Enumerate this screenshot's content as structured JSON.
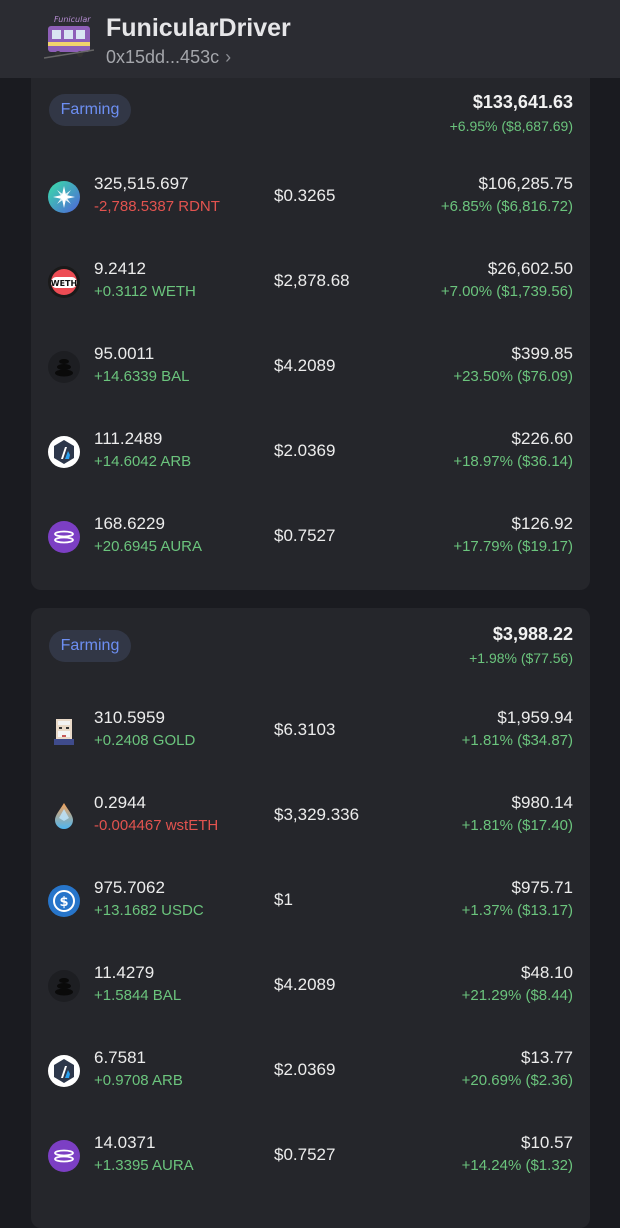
{
  "header": {
    "title": "FunicularDriver",
    "address": "0x15dd...453c",
    "chevron": "›",
    "logo_icon": "funicular-tram-icon"
  },
  "colors": {
    "background": "#1a1b20",
    "card": "#25262b",
    "positive": "#6bc47d",
    "negative": "#e2534f",
    "pill_text": "#6d8ff3"
  },
  "positions": [
    {
      "tag": "Farming",
      "total": "$133,641.63",
      "total_change": "+6.95% ($8,687.69)",
      "tokens": [
        {
          "icon": "radiant-icon",
          "amount": "325,515.697",
          "delta": "-2,788.5387 RDNT",
          "delta_sign": "neg",
          "price": "$0.3265",
          "value": "$106,285.75",
          "change": "+6.85% ($6,816.72)"
        },
        {
          "icon": "weth-icon",
          "amount": "9.2412",
          "delta": "+0.3112 WETH",
          "delta_sign": "pos",
          "price": "$2,878.68",
          "value": "$26,602.50",
          "change": "+7.00% ($1,739.56)"
        },
        {
          "icon": "balancer-icon",
          "amount": "95.0011",
          "delta": "+14.6339 BAL",
          "delta_sign": "pos",
          "price": "$4.2089",
          "value": "$399.85",
          "change": "+23.50% ($76.09)"
        },
        {
          "icon": "arbitrum-icon",
          "amount": "111.2489",
          "delta": "+14.6042 ARB",
          "delta_sign": "pos",
          "price": "$2.0369",
          "value": "$226.60",
          "change": "+18.97% ($36.14)"
        },
        {
          "icon": "aura-icon",
          "amount": "168.6229",
          "delta": "+20.6945 AURA",
          "delta_sign": "pos",
          "price": "$0.7527",
          "value": "$126.92",
          "change": "+17.79% ($19.17)"
        }
      ]
    },
    {
      "tag": "Farming",
      "total": "$3,988.22",
      "total_change": "+1.98% ($77.56)",
      "tokens": [
        {
          "icon": "gold-icon",
          "amount": "310.5959",
          "delta": "+0.2408 GOLD",
          "delta_sign": "pos",
          "price": "$6.3103",
          "value": "$1,959.94",
          "change": "+1.81% ($34.87)"
        },
        {
          "icon": "wsteth-icon",
          "amount": "0.2944",
          "delta": "-0.004467 wstETH",
          "delta_sign": "neg",
          "price": "$3,329.336",
          "value": "$980.14",
          "change": "+1.81% ($17.40)"
        },
        {
          "icon": "usdc-icon",
          "amount": "975.7062",
          "delta": "+13.1682 USDC",
          "delta_sign": "pos",
          "price": "$1",
          "value": "$975.71",
          "change": "+1.37% ($13.17)"
        },
        {
          "icon": "balancer-icon",
          "amount": "11.4279",
          "delta": "+1.5844 BAL",
          "delta_sign": "pos",
          "price": "$4.2089",
          "value": "$48.10",
          "change": "+21.29% ($8.44)"
        },
        {
          "icon": "arbitrum-icon",
          "amount": "6.7581",
          "delta": "+0.9708 ARB",
          "delta_sign": "pos",
          "price": "$2.0369",
          "value": "$13.77",
          "change": "+20.69% ($2.36)"
        },
        {
          "icon": "aura-icon",
          "amount": "14.0371",
          "delta": "+1.3395 AURA",
          "delta_sign": "pos",
          "price": "$0.7527",
          "value": "$10.57",
          "change": "+14.24% ($1.32)"
        }
      ]
    }
  ]
}
